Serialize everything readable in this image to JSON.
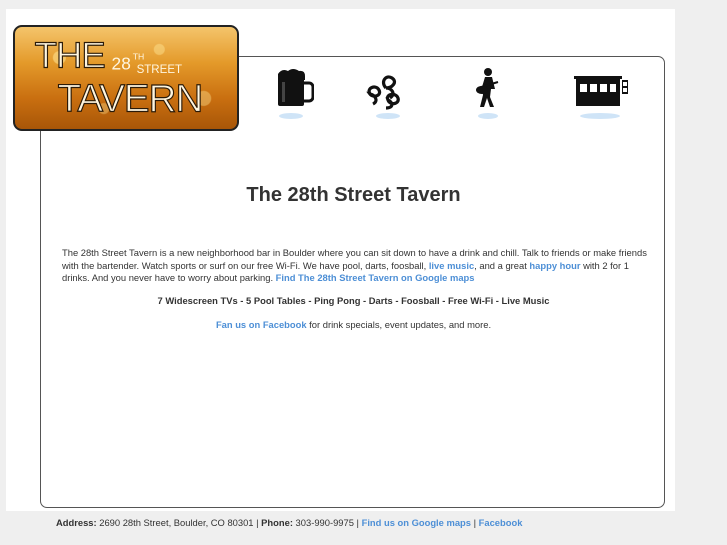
{
  "logo": {
    "line1": "THE",
    "superscript": "28",
    "superscript_suffix": "TH",
    "street": "STREET",
    "line2": "TAVERN"
  },
  "nav": {
    "icons": [
      "beer-mug-icon",
      "pretzels-icon",
      "guitarist-icon",
      "tavern-building-icon"
    ]
  },
  "main": {
    "title": "The 28th Street Tavern",
    "intro": {
      "text1": "The 28th Street Tavern is a new neighborhood bar in Boulder where you can sit down to have a drink and chill. Talk to friends or make friends with the bartender. Watch sports or surf on our free Wi-Fi. We have pool, darts, foosball, ",
      "link_live_music": "live music",
      "text2": ", and a great ",
      "link_happy_hour": "happy hour",
      "text3": " with 2 for 1 drinks. And you never have to worry about parking. ",
      "link_maps": "Find The 28th Street Tavern on Google maps"
    },
    "amenities": "7 Widescreen TVs - 5 Pool Tables - Ping Pong - Darts - Foosball - Free Wi-Fi  - Live Music",
    "fan_link": "Fan us on Facebook",
    "fan_text": " for drink specials, event updates, and more."
  },
  "footer": {
    "address_label": "Address:",
    "address_value": " 2690 28th Street, Boulder, CO 80301 | ",
    "phone_label": "Phone:",
    "phone_value": " 303-990-9975 | ",
    "maps_link": "Find us on Google maps",
    "sep": " | ",
    "facebook_link": "Facebook"
  },
  "colors": {
    "link": "#4d8fd6",
    "text": "#333333",
    "page_bg": "#efefef",
    "logo_amber": "#e49a2a"
  }
}
